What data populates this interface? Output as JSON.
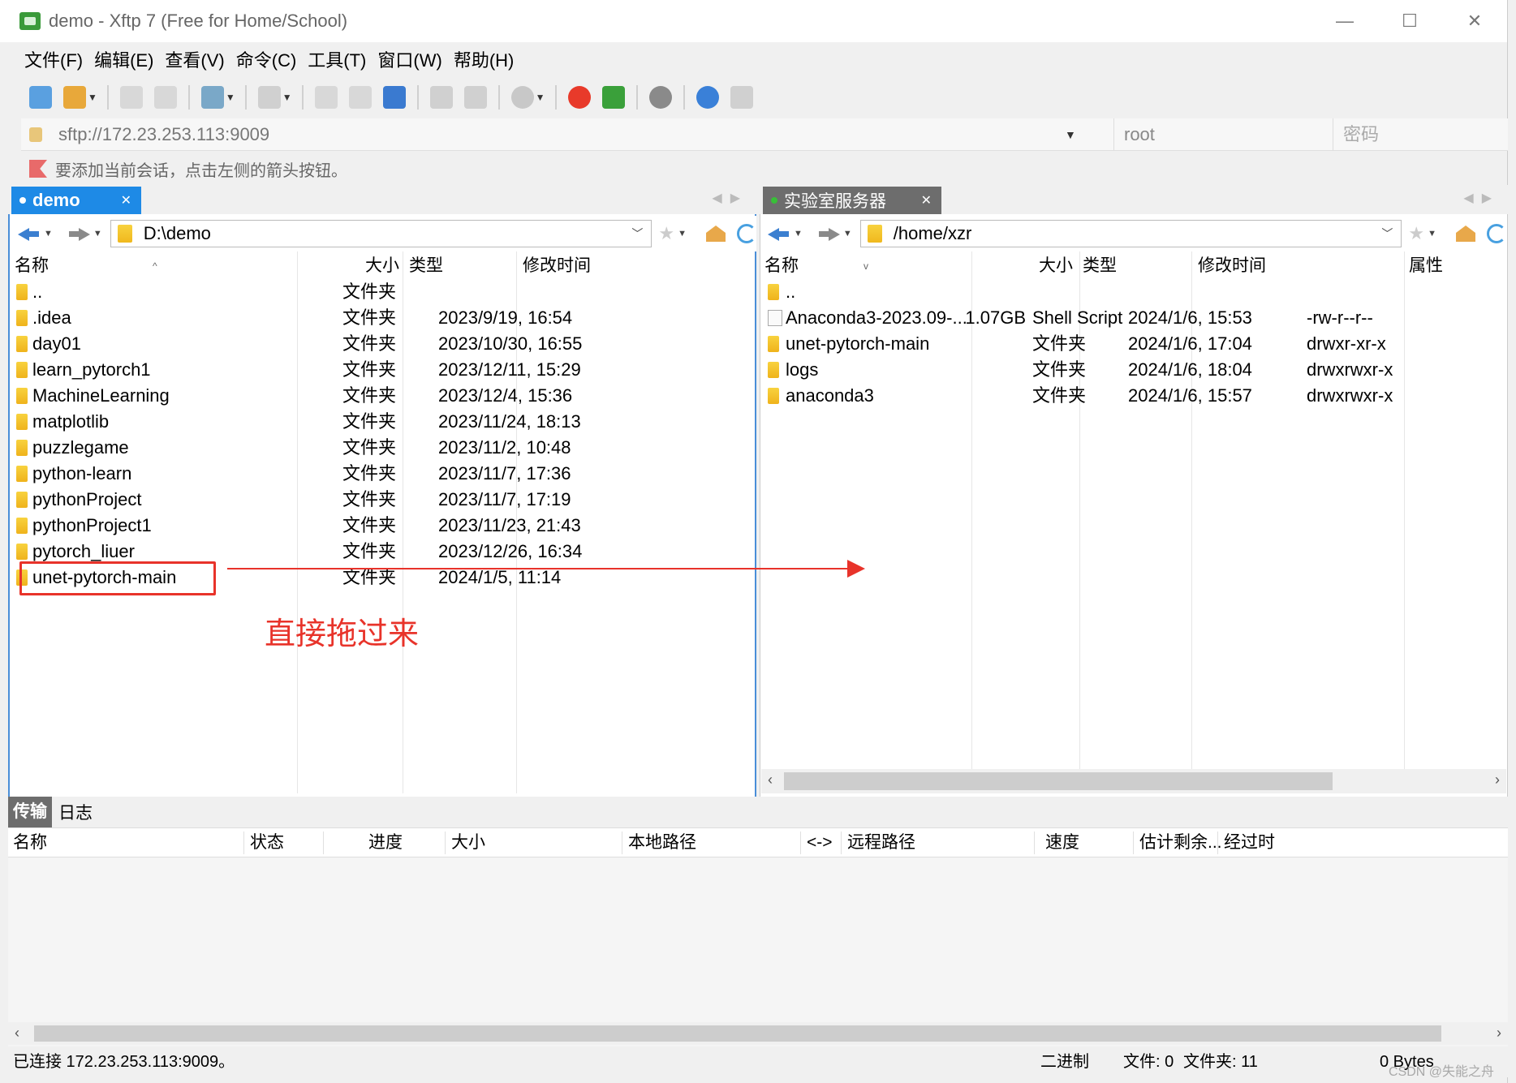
{
  "window": {
    "title": "demo - Xftp 7 (Free for Home/School)",
    "controls": {
      "minimize": "—",
      "maximize": "☐",
      "close": "✕"
    }
  },
  "menu": [
    "文件(F)",
    "编辑(E)",
    "查看(V)",
    "命令(C)",
    "工具(T)",
    "窗口(W)",
    "帮助(H)"
  ],
  "address": {
    "url": "sftp://172.23.253.113:9009",
    "user": "root",
    "password_placeholder": "密码"
  },
  "hint": "要添加当前会话，点击左侧的箭头按钮。",
  "left_pane": {
    "tab": "demo",
    "path": "D:\\demo",
    "columns": [
      "名称",
      "大小",
      "类型",
      "修改时间"
    ],
    "rows": [
      {
        "name": "..",
        "size": "",
        "type": "文件夹",
        "modified": ""
      },
      {
        "name": ".idea",
        "size": "",
        "type": "文件夹",
        "modified": "2023/9/19, 16:54"
      },
      {
        "name": "day01",
        "size": "",
        "type": "文件夹",
        "modified": "2023/10/30, 16:55"
      },
      {
        "name": "learn_pytorch1",
        "size": "",
        "type": "文件夹",
        "modified": "2023/12/11, 15:29"
      },
      {
        "name": "MachineLearning",
        "size": "",
        "type": "文件夹",
        "modified": "2023/12/4, 15:36"
      },
      {
        "name": "matplotlib",
        "size": "",
        "type": "文件夹",
        "modified": "2023/11/24, 18:13"
      },
      {
        "name": "puzzlegame",
        "size": "",
        "type": "文件夹",
        "modified": "2023/11/2, 10:48"
      },
      {
        "name": "python-learn",
        "size": "",
        "type": "文件夹",
        "modified": "2023/11/7, 17:36"
      },
      {
        "name": "pythonProject",
        "size": "",
        "type": "文件夹",
        "modified": "2023/11/7, 17:19"
      },
      {
        "name": "pythonProject1",
        "size": "",
        "type": "文件夹",
        "modified": "2023/11/23, 21:43"
      },
      {
        "name": "pytorch_liuer",
        "size": "",
        "type": "文件夹",
        "modified": "2023/12/26, 16:34"
      },
      {
        "name": "unet-pytorch-main",
        "size": "",
        "type": "文件夹",
        "modified": "2024/1/5, 11:14"
      }
    ]
  },
  "right_pane": {
    "tab": "实验室服务器",
    "path": "/home/xzr",
    "columns": [
      "名称",
      "大小",
      "类型",
      "修改时间",
      "属性"
    ],
    "rows": [
      {
        "name": "..",
        "size": "",
        "type": "",
        "modified": "",
        "attr": ""
      },
      {
        "name": "Anaconda3-2023.09-...",
        "size": "1.07GB",
        "type": "Shell Script",
        "modified": "2024/1/6, 15:53",
        "attr": "-rw-r--r--"
      },
      {
        "name": "unet-pytorch-main",
        "size": "",
        "type": "文件夹",
        "modified": "2024/1/6, 17:04",
        "attr": "drwxr-xr-x"
      },
      {
        "name": "logs",
        "size": "",
        "type": "文件夹",
        "modified": "2024/1/6, 18:04",
        "attr": "drwxrwxr-x"
      },
      {
        "name": "anaconda3",
        "size": "",
        "type": "文件夹",
        "modified": "2024/1/6, 15:57",
        "attr": "drwxrwxr-x"
      }
    ]
  },
  "annotation": "直接拖过来",
  "transfer": {
    "tabs": [
      "传输",
      "日志"
    ],
    "columns": [
      "名称",
      "状态",
      "进度",
      "大小",
      "本地路径",
      "<->",
      "远程路径",
      "速度",
      "估计剩余...",
      "经过时"
    ]
  },
  "status": {
    "connection": "已连接 172.23.253.113:9009。",
    "mode": "二进制",
    "files": "文件: 0",
    "folders": "文件夹: 11",
    "bytes": "0 Bytes"
  },
  "watermark": "CSDN @失能之舟",
  "colors": {
    "accent": "#1e8ae6",
    "annotation": "#e8332a"
  }
}
